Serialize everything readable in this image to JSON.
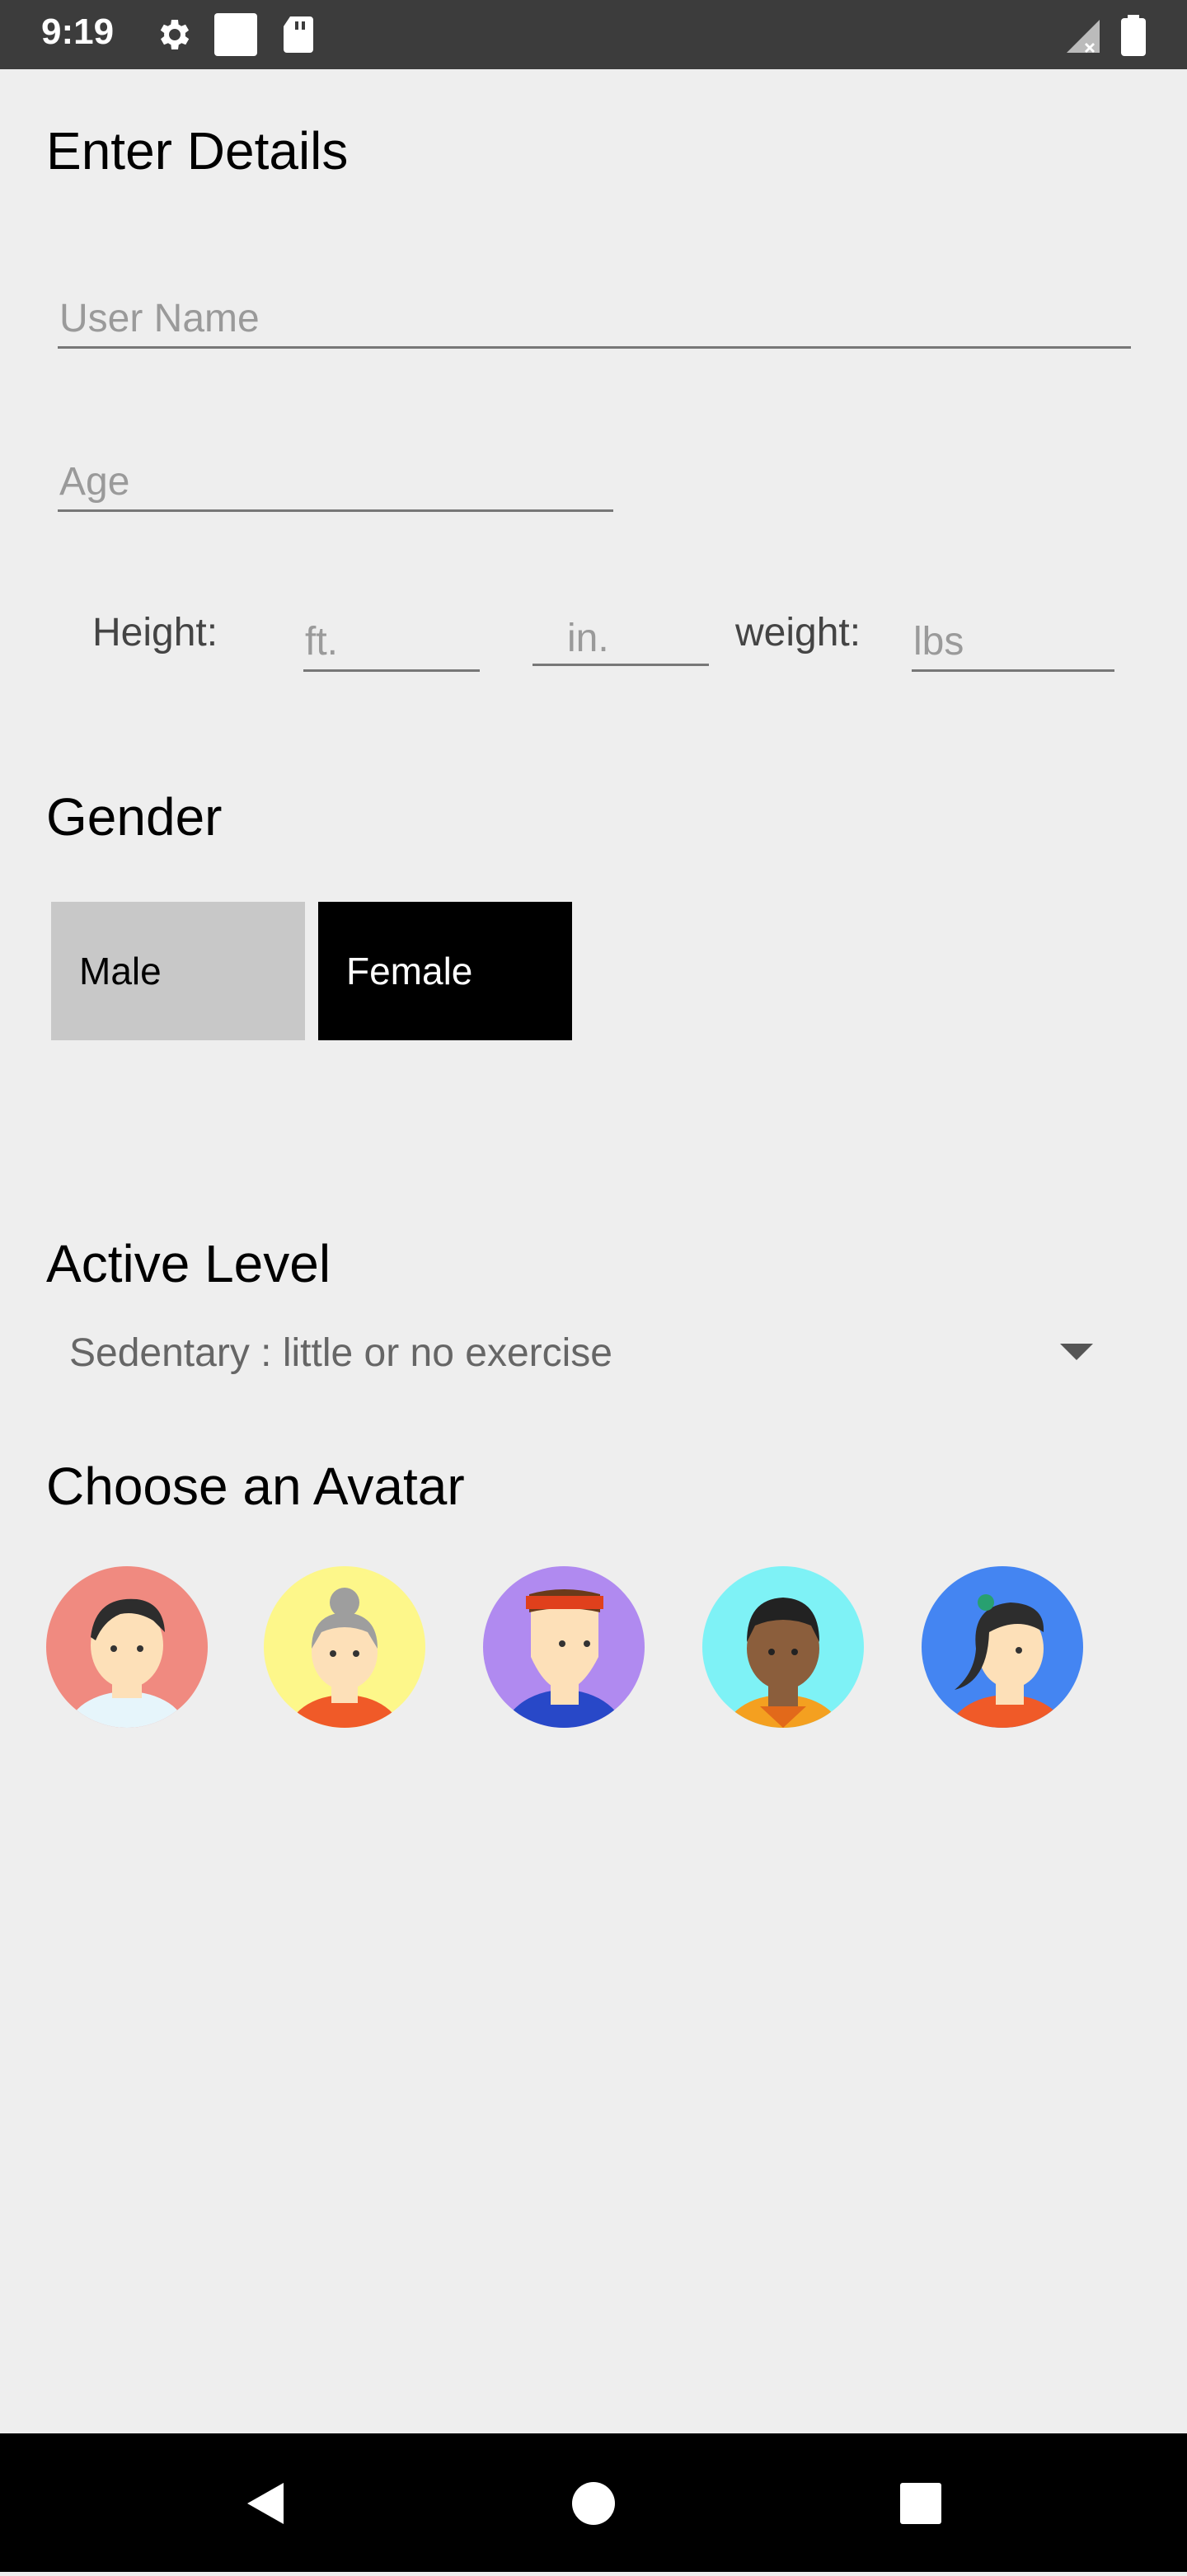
{
  "status_bar": {
    "time": "9:19"
  },
  "page": {
    "title": "Enter Details",
    "username_placeholder": "User Name",
    "age_placeholder": "Age",
    "height_label": "Height:",
    "feet_placeholder": "ft.",
    "inches_placeholder": "in.",
    "weight_label": "weight:",
    "weight_placeholder": "lbs",
    "gender_heading": "Gender",
    "gender_options": [
      "Male",
      "Female"
    ],
    "gender_selected": "Female",
    "active_heading": "Active Level",
    "active_selected": "Sedentary : little or no exercise",
    "avatar_heading": "Choose an Avatar"
  },
  "colors": {
    "status_bar": "#3c3c3c",
    "background": "#eeeeee",
    "male_button": "#c8c8c8",
    "female_button": "#000000",
    "avatar_bgs": [
      "#f08a80",
      "#fdf78a",
      "#b08af0",
      "#7ef2f6",
      "#4485f2"
    ]
  }
}
